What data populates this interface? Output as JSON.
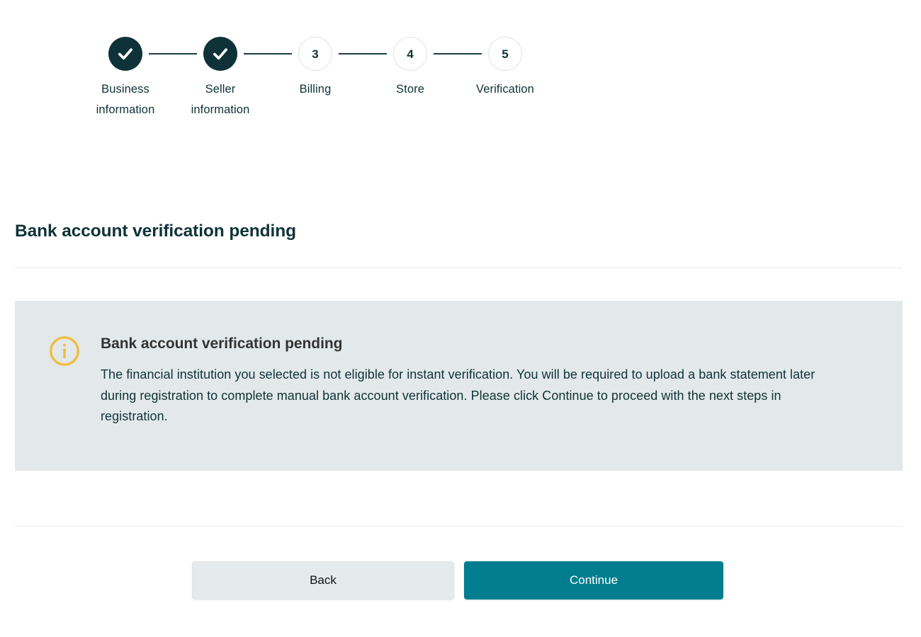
{
  "stepper": {
    "steps": [
      {
        "id": "business-information",
        "indicator": "check",
        "label": "Business information",
        "state": "completed"
      },
      {
        "id": "seller-information",
        "indicator": "check",
        "label": "Seller information",
        "state": "completed"
      },
      {
        "id": "billing",
        "indicator": "3",
        "label": "Billing",
        "state": "pending"
      },
      {
        "id": "store",
        "indicator": "4",
        "label": "Store",
        "state": "pending"
      },
      {
        "id": "verification",
        "indicator": "5",
        "label": "Verification",
        "state": "pending"
      }
    ]
  },
  "page": {
    "title": "Bank account verification pending"
  },
  "alert": {
    "icon": "info-circle-icon",
    "icon_color": "#f0bd42",
    "background_color": "#e3e9ea",
    "heading": "Bank account verification pending",
    "text": "The financial institution you selected is not eligible for instant verification. You will be required to upload a bank statement later during registration to complete manual bank account verification. Please click Continue to proceed with the next steps in registration."
  },
  "footer": {
    "back_label": "Back",
    "continue_label": "Continue"
  },
  "colors": {
    "brand_dark": "#0f3238",
    "accent_teal": "#007e8f",
    "alert_bg": "#e3e9ea",
    "info_amber": "#f0bd42",
    "divider": "#e7e7e7"
  }
}
